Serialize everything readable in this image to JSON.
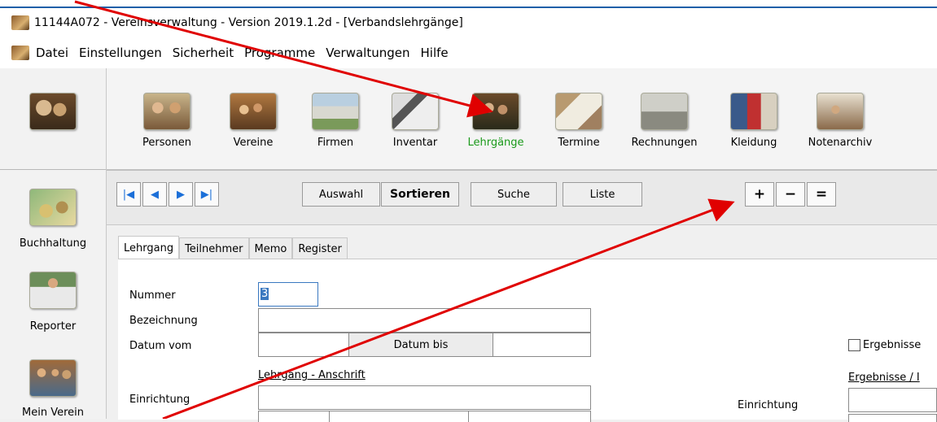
{
  "window": {
    "title": "11144A072 - Vereinsverwaltung - Version 2019.1.2d - [Verbandslehrgänge]"
  },
  "menu": [
    "Datei",
    "Einstellungen",
    "Sicherheit",
    "Programme",
    "Verwaltungen",
    "Hilfe"
  ],
  "sidebar": {
    "items": [
      {
        "label": "",
        "icon": "group-icon"
      },
      {
        "label": "Buchhaltung",
        "icon": "money-icon"
      },
      {
        "label": "Reporter",
        "icon": "presenter-icon"
      },
      {
        "label": "Mein Verein",
        "icon": "club-photo-icon"
      }
    ]
  },
  "toolbar": {
    "items": [
      {
        "label": "Personen",
        "icon": "persons-icon"
      },
      {
        "label": "Vereine",
        "icon": "clubs-icon"
      },
      {
        "label": "Firmen",
        "icon": "companies-icon"
      },
      {
        "label": "Inventar",
        "icon": "inventory-icon"
      },
      {
        "label": "Lehrgänge",
        "icon": "courses-icon",
        "active": true
      },
      {
        "label": "Termine",
        "icon": "appointments-icon"
      },
      {
        "label": "Rechnungen",
        "icon": "invoices-icon"
      },
      {
        "label": "Kleidung",
        "icon": "clothing-icon"
      },
      {
        "label": "Notenarchiv",
        "icon": "sheet-music-icon"
      }
    ],
    "active_color": "#1a9a1a"
  },
  "nav": {
    "first": "|◀",
    "prev": "◀",
    "next": "▶",
    "last": "▶|",
    "auswahl": "Auswahl",
    "sortieren": "Sortieren",
    "suche": "Suche",
    "liste": "Liste",
    "add": "+",
    "remove": "−",
    "equal": "="
  },
  "tabs": [
    "Lehrgang",
    "Teilnehmer",
    "Memo",
    "Register"
  ],
  "form": {
    "nummer_label": "Nummer",
    "nummer_value": "3",
    "bezeichnung_label": "Bezeichnung",
    "datum_vom_label": "Datum vom",
    "datum_bis_button": "Datum bis",
    "ergebnisse_checkbox": "Ergebnisse",
    "anschrift_heading": "Lehrgang - Anschrift",
    "ergebnisse_heading": "Ergebnisse / I",
    "einrichtung_label": "Einrichtung",
    "einrichtung_label_right": "Einrichtung"
  },
  "annotation_color": "#e00000"
}
